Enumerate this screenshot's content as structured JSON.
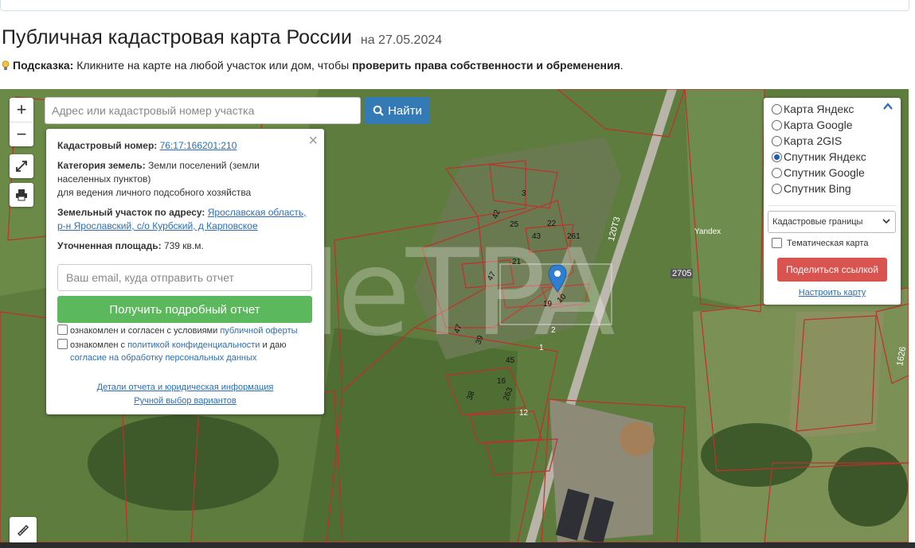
{
  "header": {
    "title": "Публичная кадастровая карта России",
    "date": "на 27.05.2024"
  },
  "hint": {
    "label": "Подсказка:",
    "text_before": "Кликните на карте на любой участок или дом, чтобы",
    "bold_text": "проверить права собственности и обременения",
    "text_after": "."
  },
  "map_controls": {
    "zoom_in": "+",
    "zoom_out": "−",
    "search_placeholder": "Адрес или кадастровый номер участка",
    "search_button": "Найти"
  },
  "info_popup": {
    "close": "×",
    "cadastral_label": "Кадастровый номер:",
    "cadastral_number": "76:17:166201:210",
    "category_label": "Категория земель:",
    "category_value": "Земли поселений (земли населенных пунктов)",
    "purpose": "для ведения личного подсобного хозяйства",
    "address_label": "Земельный участок по адресу:",
    "address_value": "Ярославская область, р-н Ярославский, с/о Курбский, д Карповское",
    "area_label": "Уточненная площадь:",
    "area_value": "739 кв.м.",
    "email_placeholder": "Ваш email, куда отправить отчет",
    "report_button": "Получить подробный отчет",
    "agree1_text": "ознакомлен и согласен с условиями",
    "agree1_link": "публичной оферты",
    "agree2_text": "ознакомлен с",
    "agree2_link": "политикой конфиденциальности",
    "agree2_mid": "и даю",
    "agree2_link2": "согласие на обработку персональных данных",
    "details_link": "Детали отчета и юридическая информация",
    "manual_link": "Ручной выбор вариантов"
  },
  "layers_panel": {
    "options": [
      {
        "label": "Карта Яндекс",
        "selected": false
      },
      {
        "label": "Карта Google",
        "selected": false
      },
      {
        "label": "Карта 2GIS",
        "selected": false
      },
      {
        "label": "Спутник Яндекс",
        "selected": true
      },
      {
        "label": "Спутник Google",
        "selected": false
      },
      {
        "label": "Спутник Bing",
        "selected": false
      }
    ],
    "overlay_select": "Кадастровые границы",
    "thematic_label": "Тематическая карта",
    "share_button": "Поделиться ссылкой",
    "configure_link": "Настроить карту"
  },
  "map_labels": {
    "road_1": "120Т3",
    "road_2": "2705",
    "provider": "Yandex",
    "edge_num": "1626",
    "watermark": "MeTPA",
    "plots": [
      "3",
      "42",
      "25",
      "22",
      "43",
      "261",
      "21",
      "47",
      "10",
      "19",
      "2",
      "47",
      "39",
      "1",
      "45",
      "16",
      "263",
      "38",
      "12"
    ]
  },
  "colors": {
    "accent_blue": "#337ab7",
    "report_green": "#5cb85c",
    "share_red": "#d9534f",
    "cadastral_border": "#c0302a"
  }
}
